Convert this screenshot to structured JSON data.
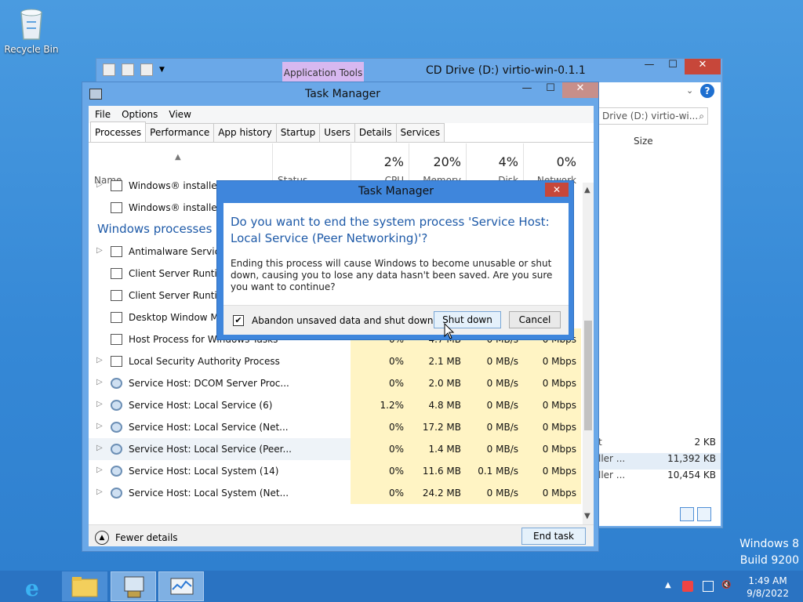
{
  "desktop": {
    "recycle_bin_label": "Recycle Bin",
    "watermark_line1": "Windows 8",
    "watermark_line2": "Build 9200"
  },
  "explorer": {
    "title": "CD Drive (D:) virtio-win-0.1.1",
    "ribbon_tab": "Application Tools",
    "search_text": "Drive (D:) virtio-wi...",
    "column_size": "Size",
    "rows": [
      {
        "name": "t",
        "size": "2 KB"
      },
      {
        "name": "ller ...",
        "size": "11,392 KB"
      },
      {
        "name": "ller ...",
        "size": "10,454 KB"
      }
    ]
  },
  "task_manager": {
    "title": "Task Manager",
    "menu": [
      "File",
      "Options",
      "View"
    ],
    "tabs": [
      "Processes",
      "Performance",
      "App history",
      "Startup",
      "Users",
      "Details",
      "Services"
    ],
    "columns": {
      "name": "Name",
      "status": "Status",
      "cpu_pct": "2%",
      "cpu_label": "CPU",
      "mem_pct": "20%",
      "mem_label": "Memory",
      "disk_pct": "4%",
      "disk_label": "Disk",
      "net_pct": "0%",
      "net_label": "Network"
    },
    "processes": [
      {
        "name": "Windows® installer",
        "cpu": "",
        "mem": "",
        "disk": "",
        "net": "",
        "expand": true,
        "icon": "installer"
      },
      {
        "name": "Windows® installer (",
        "cpu": "",
        "mem": "",
        "disk": "",
        "net": "",
        "expand": false,
        "icon": "installer"
      },
      {
        "group": "Windows processes (2"
      },
      {
        "name": "Antimalware Service E",
        "cpu": "",
        "mem": "",
        "disk": "",
        "net": "",
        "expand": true,
        "icon": "window"
      },
      {
        "name": "Client Server Runtime",
        "cpu": "",
        "mem": "",
        "disk": "",
        "net": "",
        "expand": false,
        "icon": "window"
      },
      {
        "name": "Client Server Runtime",
        "cpu": "",
        "mem": "",
        "disk": "",
        "net": "",
        "expand": false,
        "icon": "window"
      },
      {
        "name": "Desktop Window Man",
        "cpu": "",
        "mem": "",
        "disk": "",
        "net": "",
        "expand": false,
        "icon": "window"
      },
      {
        "name": "Host Process for Windows Tasks",
        "cpu": "0%",
        "mem": "4.7 MB",
        "disk": "0 MB/s",
        "net": "0 Mbps",
        "expand": false,
        "icon": "window"
      },
      {
        "name": "Local Security Authority Process",
        "cpu": "0%",
        "mem": "2.1 MB",
        "disk": "0 MB/s",
        "net": "0 Mbps",
        "expand": true,
        "icon": "window"
      },
      {
        "name": "Service Host: DCOM Server Proc...",
        "cpu": "0%",
        "mem": "2.0 MB",
        "disk": "0 MB/s",
        "net": "0 Mbps",
        "expand": true,
        "icon": "gear"
      },
      {
        "name": "Service Host: Local Service (6)",
        "cpu": "1.2%",
        "mem": "4.8 MB",
        "disk": "0 MB/s",
        "net": "0 Mbps",
        "expand": true,
        "icon": "gear"
      },
      {
        "name": "Service Host: Local Service (Net...",
        "cpu": "0%",
        "mem": "17.2 MB",
        "disk": "0 MB/s",
        "net": "0 Mbps",
        "expand": true,
        "icon": "gear"
      },
      {
        "name": "Service Host: Local Service (Peer...",
        "cpu": "0%",
        "mem": "1.4 MB",
        "disk": "0 MB/s",
        "net": "0 Mbps",
        "expand": true,
        "icon": "gear",
        "selected": true
      },
      {
        "name": "Service Host: Local System (14)",
        "cpu": "0%",
        "mem": "11.6 MB",
        "disk": "0.1 MB/s",
        "net": "0 Mbps",
        "expand": true,
        "icon": "gear"
      },
      {
        "name": "Service Host: Local System (Net...",
        "cpu": "0%",
        "mem": "24.2 MB",
        "disk": "0 MB/s",
        "net": "0 Mbps",
        "expand": true,
        "icon": "gear"
      }
    ],
    "fewer_details": "Fewer details",
    "end_task": "End task"
  },
  "dialog": {
    "title": "Task Manager",
    "main_instruction": "Do you want to end the system process 'Service Host: Local Service (Peer Networking)'?",
    "content": "Ending this process will cause Windows to become unusable or shut down, causing you to lose any data hasn't been saved. Are you sure you want to continue?",
    "checkbox_label": "Abandon unsaved data and shut down.",
    "checkbox_checked": true,
    "shutdown_button": "Shut down",
    "cancel_button": "Cancel"
  },
  "taskbar": {
    "time": "1:49 AM",
    "date": "9/8/2022"
  }
}
